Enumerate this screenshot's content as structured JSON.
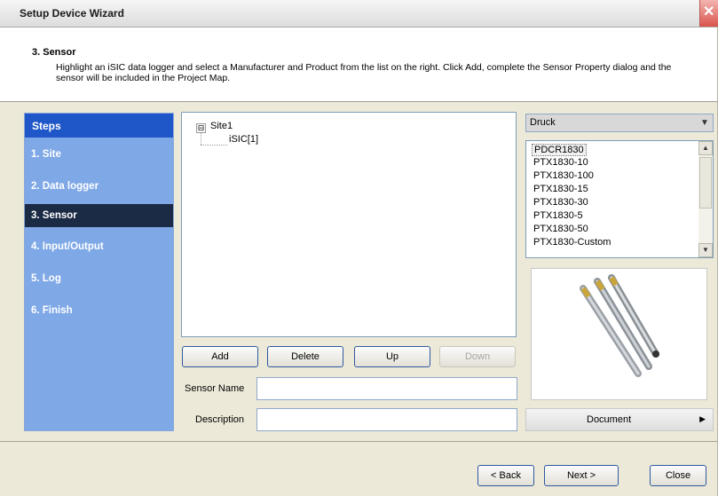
{
  "window": {
    "title": "Setup Device Wizard"
  },
  "header": {
    "step_title": "3. Sensor",
    "instructions": "Highlight an iSIC data logger and select a Manufacturer and Product from the list on the right. Click Add, complete the Sensor Property dialog and the sensor will be included in the Project Map."
  },
  "steps": {
    "header": "Steps",
    "items": [
      {
        "label": "1. Site"
      },
      {
        "label": "2. Data logger"
      },
      {
        "label": "3. Sensor"
      },
      {
        "label": "4. Input/Output"
      },
      {
        "label": "5. Log"
      },
      {
        "label": "6. Finish"
      }
    ]
  },
  "tree": {
    "expander": "⊟",
    "site": "Site1",
    "logger": "iSIC[1]"
  },
  "actions": {
    "add": "Add",
    "delete": "Delete",
    "up": "Up",
    "down": "Down"
  },
  "fields": {
    "sensor_name_label": "Sensor Name",
    "sensor_name_value": "",
    "description_label": "Description",
    "description_value": ""
  },
  "manufacturer": {
    "selected": "Druck"
  },
  "products": {
    "items": [
      "PDCR1830",
      "PTX1830-10",
      "PTX1830-100",
      "PTX1830-15",
      "PTX1830-30",
      "PTX1830-5",
      "PTX1830-50",
      "PTX1830-Custom"
    ],
    "selected_index": 0
  },
  "document_button": {
    "label": "Document"
  },
  "footer": {
    "back": "< Back",
    "next": "Next >",
    "close": "Close"
  },
  "icons": {
    "close": "close-icon",
    "dropdown": "chevron-down-icon",
    "scroll_up": "scroll-up-icon",
    "scroll_down": "scroll-down-icon",
    "menu_arrow": "chevron-right-icon"
  },
  "colors": {
    "steps_bg": "#7fa8e6",
    "steps_header": "#1f57c8",
    "active_step": "#1b2a45",
    "button_border": "#2f5aa1"
  }
}
